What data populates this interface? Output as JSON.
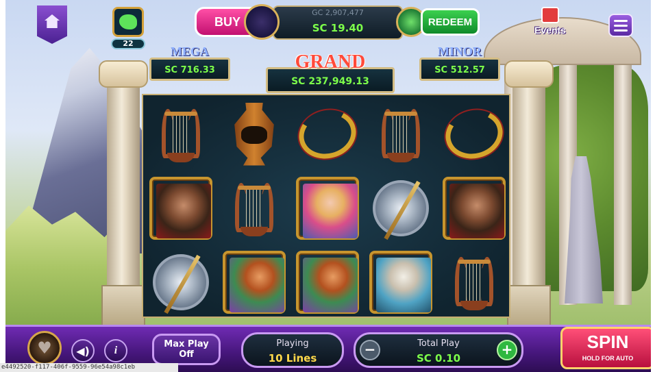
{
  "top": {
    "buy_label": "BUY",
    "gc_balance": "GC 2,907,477",
    "sc_balance": "SC 19.40",
    "redeem_label": "REDEEM"
  },
  "profile": {
    "level": "22"
  },
  "events_label": "Events",
  "jackpots": {
    "mega": {
      "title": "MEGA",
      "value": "SC 716.33"
    },
    "grand": {
      "title": "GRAND",
      "value": "SC 237,949.13"
    },
    "minor": {
      "title": "MINOR",
      "value": "SC 512.57"
    }
  },
  "reels": [
    [
      "lyre",
      "vase",
      "wreath",
      "lyre",
      "wreath"
    ],
    [
      "hades",
      "lyre",
      "aphrodite",
      "shield",
      "hades"
    ],
    [
      "shield",
      "archer",
      "archer",
      "zeus",
      "lyre"
    ]
  ],
  "bottom": {
    "max_play_line1": "Max Play",
    "max_play_line2": "Off",
    "playing_label": "Playing",
    "playing_value": "10 Lines",
    "total_label": "Total Play",
    "total_value": "SC 0.10",
    "minus": "−",
    "plus": "+",
    "spin_label": "SPIN",
    "spin_sub": "HOLD FOR AUTO",
    "info": "i"
  },
  "footer_id": "e4492520-f117-406f-9559-96e54a98c1eb",
  "icons": [
    "home-icon",
    "duck-avatar-icon",
    "menu-icon",
    "events-calendar-icon",
    "heart-icon",
    "sound-icon",
    "info-icon",
    "coin-icon",
    "gem-icon"
  ],
  "colors": {
    "accent_green": "#7dff4a",
    "buy_pink": "#ff4fa6",
    "redeem_green": "#3cd04f",
    "spin_red": "#ff4f78",
    "bar_purple": "#6f2bb3"
  }
}
